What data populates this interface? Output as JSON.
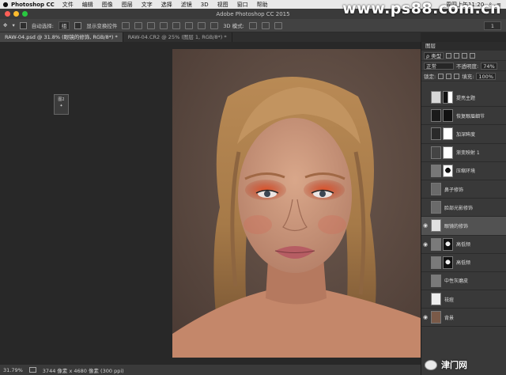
{
  "menubar": {
    "apple": "",
    "app": "Photoshop CC",
    "items": [
      "文件",
      "编辑",
      "图像",
      "图层",
      "文字",
      "选择",
      "滤镜",
      "3D",
      "视图",
      "窗口",
      "帮助"
    ],
    "clock": "周四上午11:20"
  },
  "titlebar": {
    "title": "Adobe Photoshop CC 2015",
    "watermark": "www.ps88.com.cn"
  },
  "options": {
    "auto_select_label": "自动选择:",
    "auto_select_value": "组",
    "show_transform": "显示变换控件",
    "mode_3d": "3D 模式:",
    "right_value": "1"
  },
  "tabs": [
    {
      "label": "RAW-04.psd @ 31.8% (眼镜的修饰, RGB/8*) *",
      "active": true
    },
    {
      "label": "RAW-04.CR2 @ 25% (图层 1, RGB/8*) *",
      "active": false
    }
  ],
  "float_doc": {
    "line1": "图2",
    "line2": "✦"
  },
  "status": {
    "zoom": "31.79%",
    "doc_info": "3744 像素 x 4680 像素 (300 ppi)"
  },
  "panel": {
    "tab": "图层",
    "kind": "ρ 类型",
    "blend": "正常",
    "opacity_label": "不透明度:",
    "opacity": "74%",
    "lock_label": "锁定:",
    "fill_label": "填充:",
    "fill": "100%"
  },
  "layers": [
    {
      "name": "提亮主题",
      "visible": false,
      "thumb": "#d8d8d8",
      "mask": "black-white"
    },
    {
      "name": "恢复眼眉细节",
      "visible": false,
      "thumb": "#1a1a1a",
      "mask": "dark"
    },
    {
      "name": "加深眸度",
      "visible": false,
      "thumb": "#2a2a2a",
      "mask": "white"
    },
    {
      "name": "渐变映射 1",
      "visible": false,
      "thumb": "#444",
      "mask": "white"
    },
    {
      "name": "压缩环境",
      "visible": false,
      "thumb": "#777",
      "mask": "face"
    },
    {
      "name": "鼻子修饰",
      "visible": false,
      "thumb": "#6a6a6a",
      "mask": "none"
    },
    {
      "name": "脸部光影修饰",
      "visible": false,
      "thumb": "#6a6a6a",
      "mask": "none"
    },
    {
      "name": "眼镜的修饰",
      "visible": true,
      "thumb": "#e0e0e0",
      "mask": "none",
      "active": true
    },
    {
      "name": "高低频",
      "visible": true,
      "thumb": "#7a7a7a",
      "mask": "face-dark"
    },
    {
      "name": "高低频",
      "visible": false,
      "thumb": "#7a7a7a",
      "mask": "face-dark"
    },
    {
      "name": "中性灰磨皮",
      "visible": false,
      "thumb": "#7a7a7a",
      "mask": "none"
    },
    {
      "name": "祛痘",
      "visible": false,
      "thumb": "#eee",
      "mask": "none"
    },
    {
      "name": "背景",
      "visible": true,
      "thumb": "#7a5a48",
      "mask": "none"
    }
  ],
  "footer": {
    "brand": "津门网"
  },
  "colors": {
    "menubar": "#e8e8e8",
    "close": "#ff5f57",
    "minimize": "#febc2e",
    "zoom": "#28c840",
    "canvas_bg": "#5f4d45",
    "active_layer": "#525252"
  }
}
